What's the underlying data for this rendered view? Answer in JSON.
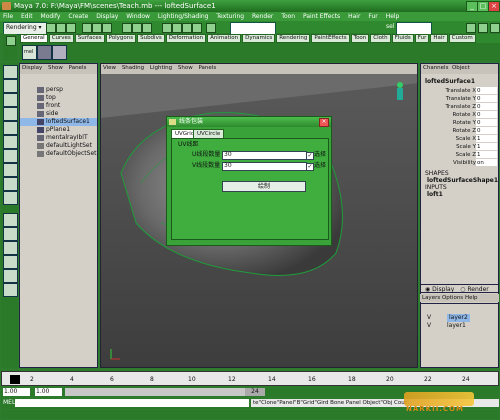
{
  "window": {
    "title": "Maya 7.0: F:\\Maya\\FM\\scenes\\Teach.mb  ---  loftedSurface1"
  },
  "menubar": [
    "File",
    "Edit",
    "Modify",
    "Create",
    "Display",
    "Window",
    "Lighting/Shading",
    "Texturing",
    "Render",
    "Toon",
    "Paint Effects",
    "Hair",
    "Fur",
    "Help"
  ],
  "statusline": {
    "menuset": "Rendering",
    "field_label": "sel"
  },
  "shelf_tabs": [
    "General",
    "Curves",
    "Surfaces",
    "Polygons",
    "Subdivs",
    "Deformation",
    "Animation",
    "Dynamics",
    "Rendering",
    "PaintEffects",
    "Toon",
    "Cloth",
    "Fluids",
    "Fur",
    "Hair",
    "Custom"
  ],
  "shelf_active_tab": "General",
  "outliner": {
    "menu": [
      "Display",
      "Show",
      "Panels"
    ],
    "items": [
      "persp",
      "top",
      "front",
      "side",
      "loftedSurface1",
      "pPlane1",
      "mentalrayIblT",
      "defaultLightSet",
      "defaultObjectSet"
    ],
    "selected": "loftedSurface1"
  },
  "viewport": {
    "menu": [
      "View",
      "Shading",
      "Lighting",
      "Show",
      "Panels"
    ]
  },
  "channelbox": {
    "tabs": [
      "Channels",
      "Object"
    ],
    "object": "loftedSurface1",
    "rows": [
      {
        "label": "Translate X",
        "value": "0"
      },
      {
        "label": "Translate Y",
        "value": "0"
      },
      {
        "label": "Translate Z",
        "value": "0"
      },
      {
        "label": "Rotate X",
        "value": "0"
      },
      {
        "label": "Rotate Y",
        "value": "0"
      },
      {
        "label": "Rotate Z",
        "value": "0"
      },
      {
        "label": "Scale X",
        "value": "1"
      },
      {
        "label": "Scale Y",
        "value": "1"
      },
      {
        "label": "Scale Z",
        "value": "1"
      },
      {
        "label": "Visibility",
        "value": "on"
      }
    ],
    "shapes_header": "SHAPES",
    "shape": "loftedSurfaceShape1",
    "inputs_header": "INPUTS",
    "input": "loft1"
  },
  "dialog": {
    "title": "线条包装",
    "tabs": [
      "UVGrid",
      "UVCircle"
    ],
    "section": "UV线距",
    "u_label": "U线段数量",
    "u_value": "30",
    "v_label": "V线段数量",
    "v_value": "30",
    "check_label": "选择",
    "button_label": "绘制"
  },
  "layers": {
    "mode_display": "Display",
    "mode_render": "Render",
    "menu": [
      "Layers",
      "Options",
      "Help"
    ],
    "items": [
      {
        "v": "V",
        "name": "layer2"
      },
      {
        "v": "V",
        "name": "layer1"
      }
    ]
  },
  "time": {
    "ticks": [
      "2",
      "4",
      "6",
      "8",
      "10",
      "12",
      "14",
      "16",
      "18",
      "20",
      "22",
      "24"
    ],
    "start": "1.00",
    "start2": "1.00",
    "end": "24",
    "cmd_label": "MEL",
    "cmd_text": "te\"Clone\"Panel\"B\"Grid\"Gird Bone Panel Object\"Obj Cour"
  },
  "watermark": {
    "text": "NARKII.COM"
  }
}
